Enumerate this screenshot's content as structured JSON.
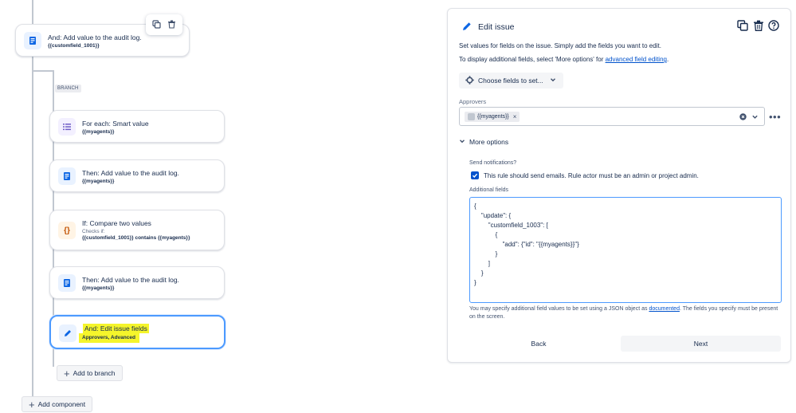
{
  "canvas": {
    "top_card": {
      "title": "And: Add value to the audit log.",
      "sub": "{{customfield_1001}}"
    },
    "branch_label": "BRANCH",
    "for_each": {
      "title": "For each: Smart value",
      "sub": "{{myagents}}"
    },
    "then1": {
      "title": "Then: Add value to the audit log.",
      "sub": "{{myagents}}"
    },
    "if_card": {
      "title": "If: Compare two values",
      "checks": "Checks if:",
      "sub": "{{customfield_1001}} contains {{myagents}}"
    },
    "then2": {
      "title": "Then: Add value to the audit log.",
      "sub": "{{myagents}}"
    },
    "and_edit": {
      "title": "And: Edit issue fields",
      "sub": "Approvers, Advanced"
    },
    "add_to_branch": "Add to branch",
    "add_component": "Add component"
  },
  "panel": {
    "title": "Edit issue",
    "desc1": "Set values for fields on the issue. Simply add the fields you want to edit.",
    "desc2_prefix": "To display additional fields, select 'More options' for ",
    "desc2_link": "advanced field editing",
    "desc2_suffix": ".",
    "choose_fields": "Choose fields to set...",
    "approvers_label": "Approvers",
    "approver_chip": "{{myagents}}",
    "more_options": "More options",
    "send_notifications_label": "Send notifications?",
    "send_notifications_text": "This rule should send emails. Rule actor must be an admin or project admin.",
    "additional_fields_label": "Additional fields",
    "json_lines": [
      "{",
      "    \"update\": {",
      "        \"customfield_1003\": [",
      "            {",
      "                \"add\": {\"id\": \"{{myagents}}\"}",
      "            }",
      "        ]",
      "    }",
      "}"
    ],
    "helper_prefix": "You may specify additional field values to be set using a JSON object as ",
    "helper_link": "documented",
    "helper_suffix": ". The fields you specify must be present on the screen.",
    "back": "Back",
    "next": "Next"
  },
  "colors": {
    "accent": "#0052cc",
    "selected_border": "#4c9aff",
    "highlight": "#f5f52b"
  }
}
